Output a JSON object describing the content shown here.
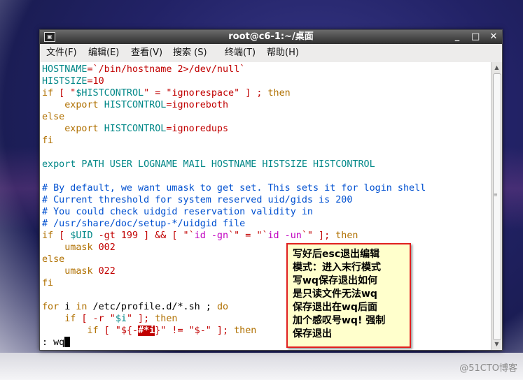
{
  "window": {
    "title": "root@c6-1:~/桌面",
    "icon_glyph": "▣",
    "buttons": {
      "minimize": "_",
      "maximize": "□",
      "close": "✕"
    }
  },
  "menu": [
    "文件(F)",
    "编辑(E)",
    "查看(V)",
    "搜索 (S)",
    "终端(T)",
    "帮助(H)"
  ],
  "terminal": {
    "l1a": "HOSTNAME",
    "l1b": "=`/bin/hostname 2>/dev/null`",
    "l2a": "HISTSIZE",
    "l2b": "=10",
    "l3a": "if",
    "l3b": " [ \"",
    "l3c": "$HISTCONTROL",
    "l3d": "\" = \"",
    "l3e": "ignorespace",
    "l3f": "\" ] ; ",
    "l3g": "then",
    "l4a": "    export ",
    "l4b": "HISTCONTROL",
    "l4c": "=",
    "l4d": "ignoreboth",
    "l5": "else",
    "l6a": "    export ",
    "l6b": "HISTCONTROL",
    "l6c": "=",
    "l6d": "ignoredups",
    "l7": "fi",
    "l8": "export PATH USER LOGNAME MAIL HOSTNAME HISTSIZE HISTCONTROL",
    "c1": "# By default, we want umask to get set. This sets it for login shell",
    "c2": "# Current threshold for system reserved uid/gids is 200",
    "c3": "# You could check uidgid reservation validity in",
    "c4": "# /usr/share/doc/setup-*/uidgid file",
    "l9a": "if",
    "l9b": " [ ",
    "l9c": "$UID",
    "l9d": " -gt 199 ] && [ \"`",
    "l9e": "id -gn",
    "l9f": "`\" = \"`",
    "l9g": "id -un",
    "l9h": "`\" ]; ",
    "l9i": "then",
    "l10a": "    umask ",
    "l10b": "002",
    "l11": "else",
    "l12a": "    umask ",
    "l12b": "022",
    "l13": "fi",
    "l14a": "for",
    "l14b": " i ",
    "l14c": "in",
    "l14d": " /etc/profile.d/*.sh ; ",
    "l14e": "do",
    "l15a": "    if",
    "l15b": " [ -r \"",
    "l15c": "$i",
    "l15d": "\" ]; ",
    "l15e": "then",
    "l16a": "        if",
    "l16b": " [ \"${-",
    "l16c": "#*i",
    "l16d": "}\" != \"$-\" ]; ",
    "l16e": "then",
    "cmd": ": wq"
  },
  "callout": {
    "lines": [
      "写好后esc退出编辑",
      "模式：进入末行模式",
      "写wq保存退出如何",
      "是只读文件无法wq",
      "保存退出在wq后面",
      "加个感叹号wq! 强制",
      "保存退出"
    ]
  },
  "watermark": "@51CTO博客",
  "colors": {
    "keyword": "#b07000",
    "variable": "#008787",
    "string": "#c10000",
    "comment": "#0050d0",
    "callout_border": "#e02020",
    "callout_bg": "#ffffcc"
  }
}
